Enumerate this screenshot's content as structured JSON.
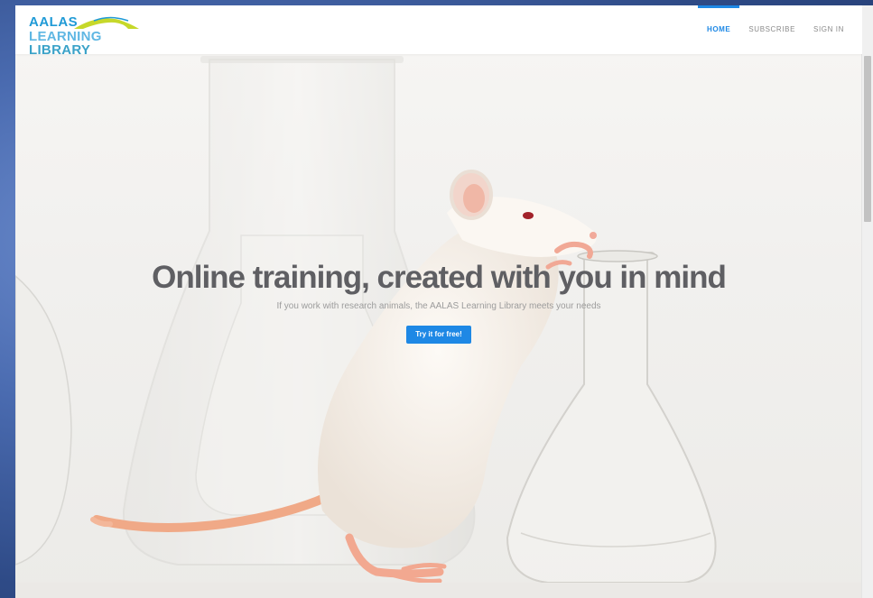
{
  "logo": {
    "line1": "AALAS",
    "line2_a": "LEARNING",
    "line2_b": "LIBRARY"
  },
  "nav": {
    "items": [
      {
        "label": "HOME",
        "active": true
      },
      {
        "label": "SUBSCRIBE",
        "active": false
      },
      {
        "label": "SIGN IN",
        "active": false
      }
    ]
  },
  "hero": {
    "title": "Online training, created with you in mind",
    "subtitle": "If you work with research animals, the AALAS Learning Library meets your needs",
    "cta_label": "Try it for free!"
  },
  "colors": {
    "accent": "#1e88e5",
    "logo_blue": "#1f9ad6",
    "logo_green": "#c6d82a",
    "title_gray": "#5f5f63"
  }
}
